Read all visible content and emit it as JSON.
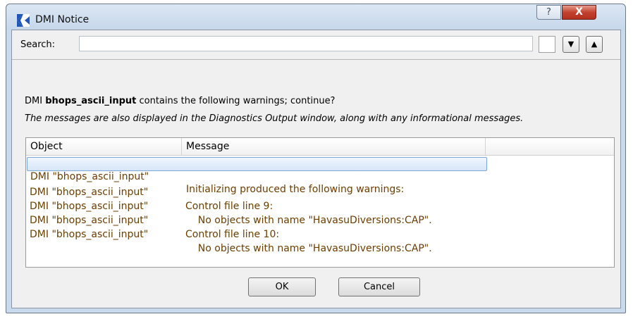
{
  "window": {
    "title": "DMI Notice",
    "help_label": "?",
    "close_label": "X"
  },
  "search": {
    "label": "Search:",
    "value": "",
    "placeholder": "",
    "down_label": "▼",
    "up_label": "▲"
  },
  "message": {
    "prefix": "DMI ",
    "dmi_name": "bhops_ascii_input",
    "suffix": " contains the following warnings; continue?",
    "note": "The messages are also displayed in the Diagnostics Output window, along with any informational messages."
  },
  "table": {
    "columns": [
      "Object",
      "Message",
      ""
    ],
    "rows": [
      {
        "object": "DMI \"bhops_ascii_input\"",
        "message": "Initializing produced the following warnings:"
      },
      {
        "object": "DMI \"bhops_ascii_input\"",
        "message": "Control file line 9:"
      },
      {
        "object": "DMI \"bhops_ascii_input\"",
        "message": "    No objects with name \"HavasuDiversions:CAP\"."
      },
      {
        "object": "DMI \"bhops_ascii_input\"",
        "message": "Control file line 10:"
      },
      {
        "object": "DMI \"bhops_ascii_input\"",
        "message": "    No objects with name \"HavasuDiversions:CAP\"."
      }
    ],
    "selected_row": 0
  },
  "buttons": {
    "ok": "OK",
    "cancel": "Cancel"
  },
  "colors": {
    "row_text": "#6b3e00",
    "close_button": "#c2422f"
  },
  "icons": {
    "app": "riverware-logo-icon",
    "help": "help-icon",
    "close": "close-icon"
  }
}
